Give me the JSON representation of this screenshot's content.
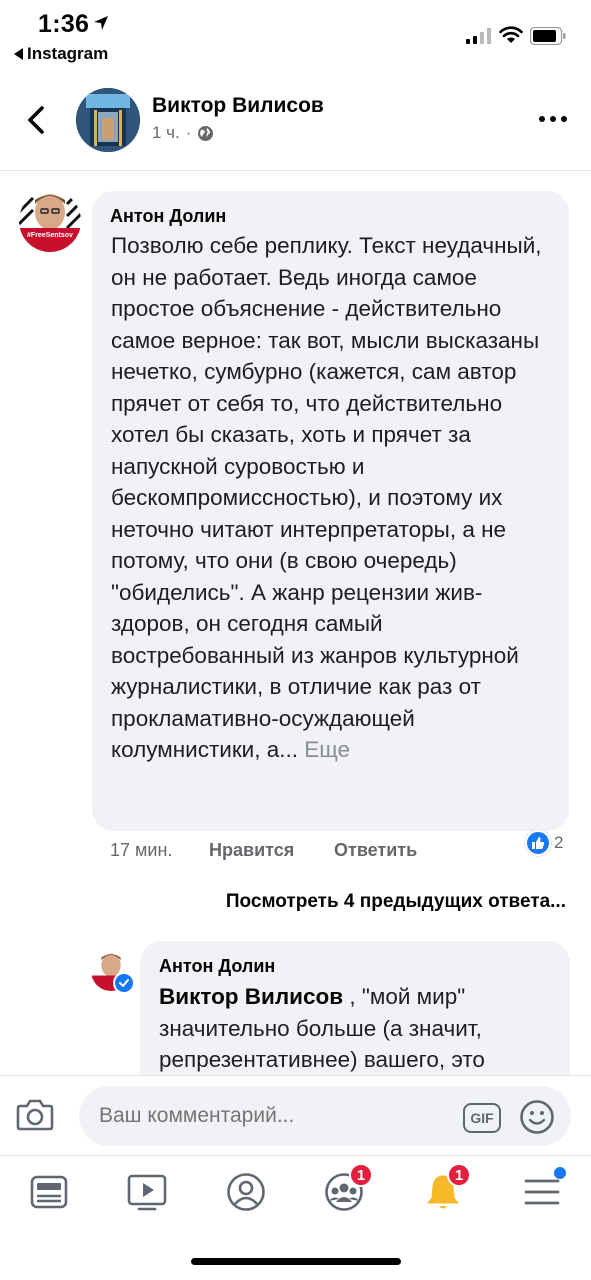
{
  "status_bar": {
    "time": "1:36",
    "back_app": "Instagram"
  },
  "header": {
    "name": "Виктор Вилисов",
    "time_ago": "1 ч.",
    "separator": "·"
  },
  "comment": {
    "author": "Антон Долин",
    "text": "Позволю себе реплику. Текст неудачный, он не работает. Ведь иногда самое простое объяснение - действительно самое верное: так вот, мысли высказаны нечетко, сумбурно (кажется, сам автор прячет от себя то, что действительно хотел бы сказать, хоть и прячет за напускной суровостью и бескомпромиссностью), и поэтому их неточно читают интерпретаторы, а не потому, что они (в свою очередь) \"обиделись\". А жанр рецензии жив-здоров, он сегодня самый востребованный из жанров культурной журналистики, в отличие как раз от прокламативно-осуждающей колумнистики, а...",
    "see_more": "Еще",
    "time_ago": "17 мин.",
    "like_label": "Нравится",
    "reply_label": "Ответить",
    "reaction_count": "2",
    "avatar_text": "#FreeSentsov"
  },
  "previous_replies": "Посмотреть 4 предыдущих ответа...",
  "reply": {
    "author": "Антон Долин",
    "mention": "Виктор Вилисов",
    "text": " , \"мой мир\" значительно больше (а значит, репрезентативнее) вашего, это"
  },
  "composer": {
    "placeholder": "Ваш комментарий...",
    "gif_label": "GIF"
  },
  "tabbar": {
    "tabs": [
      {
        "icon": "news-feed-icon"
      },
      {
        "icon": "watch-icon"
      },
      {
        "icon": "profile-icon"
      },
      {
        "icon": "groups-icon",
        "badge": "1"
      },
      {
        "icon": "notifications-icon",
        "badge": "1"
      },
      {
        "icon": "menu-icon"
      }
    ]
  },
  "colors": {
    "accent": "#1877f2",
    "badge": "#e41e3f",
    "bubble": "#f0f2f5",
    "secondary_text": "#65676b"
  }
}
